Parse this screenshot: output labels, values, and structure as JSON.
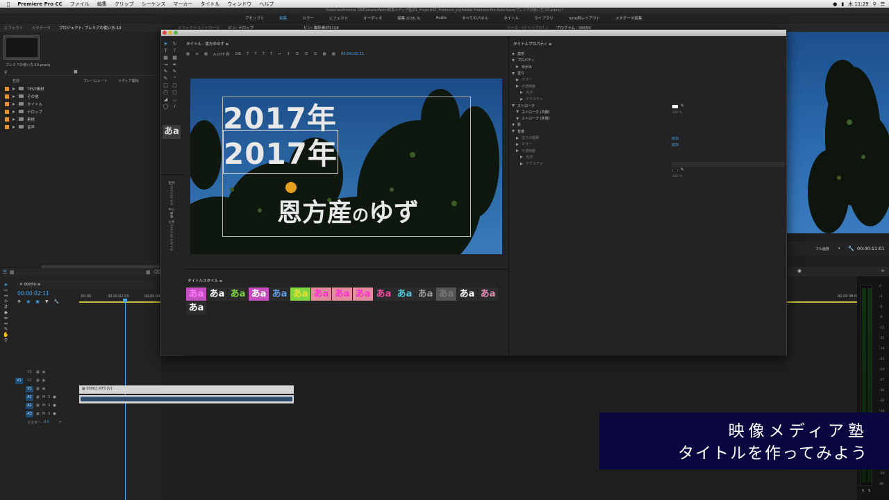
{
  "menubar": {
    "app": "Premiere Pro CC",
    "items": [
      "ファイル",
      "編集",
      "クリップ",
      "シーケンス",
      "マーカー",
      "タイトル",
      "ウィンドウ",
      "ヘルプ"
    ],
    "clock": "木 11:29"
  },
  "path": "/Volumes/Promise RAID/share/Work/映像メディア塾/01_Project/01_Premiere_prj/Adobe Premiere Pro Auto-Save/プレミアの使い方-10.prproj *",
  "workspaces": [
    "アセンブリ",
    "編集",
    "カラー",
    "エフェクト",
    "オーディオ",
    "編集 (CS5.5)",
    "Audio",
    "すべてのパネル",
    "タイトル",
    "ライブラリ",
    "note用レイアウト",
    "メタデータ編集"
  ],
  "project_panel": {
    "tabs": [
      "エフェクト",
      "メタデータ",
      "プロジェクト: プレミアの使い方-10"
    ],
    "filename": "プレミアの使い方-10.prproj",
    "columns": [
      "名前",
      "フレームレート",
      "メディア開始"
    ],
    "folders": [
      "TEST素材",
      "その他",
      "タイトル",
      "テロップ",
      "素材",
      "音声"
    ]
  },
  "title_window": {
    "header": "タイトル : 恩方のゆず",
    "font": "A-OTF 新",
    "style": "DB",
    "timecode": "00:00:02:11",
    "text_line1": "2017年",
    "text_line2": "2017年",
    "text_line3_a": "恩方産",
    "text_line3_b": "の",
    "text_line3_c": "ゆず",
    "styles_header": "タイトルスタイル",
    "swatch_text": "あa",
    "tools_labels": {
      "align": "整列",
      "center": "中心",
      "distribute": "分布"
    }
  },
  "title_props": {
    "header": "タイトルプロパティ",
    "rows": [
      {
        "t": "変形",
        "indent": 0
      },
      {
        "t": "プロパティ",
        "indent": 0
      },
      {
        "t": "ゆがみ",
        "indent": 1
      },
      {
        "t": "塗り",
        "indent": 0
      },
      {
        "t": "カラー",
        "indent": 1,
        "dim": true
      },
      {
        "t": "不透明度",
        "indent": 1,
        "dim": true
      },
      {
        "t": "光沢",
        "indent": 2,
        "dim": true
      },
      {
        "t": "テクスチャ",
        "indent": 2,
        "dim": true
      },
      {
        "t": "ストローク",
        "indent": 0
      },
      {
        "t": "ストローク (内側)",
        "indent": 1
      },
      {
        "t": "ストローク (外側)",
        "indent": 1
      },
      {
        "t": "影",
        "indent": 0
      },
      {
        "t": "背景",
        "indent": 0
      },
      {
        "t": "塗りの種類",
        "indent": 1,
        "dim": true
      },
      {
        "t": "カラー",
        "indent": 1,
        "dim": true
      },
      {
        "t": "不透明度",
        "indent": 1,
        "dim": true
      },
      {
        "t": "光沢",
        "indent": 2,
        "dim": true
      },
      {
        "t": "テクスチャ",
        "indent": 2,
        "dim": true
      }
    ],
    "opacity_val": "100 %",
    "add_label": "追加"
  },
  "source_tabs": {
    "effect_controls": "エフェクトコントロール",
    "bin": "ビン: テロップ",
    "bin2": "ビン: 撮影素材1218",
    "source": "ソース : (クリップなし)",
    "program": "プログラム : 00050"
  },
  "program": {
    "quality": "フル画質",
    "timecode": "00:00:11:01"
  },
  "timeline": {
    "sequence": "00050",
    "timecode": "00:00:02:11",
    "ruler": [
      ":00:00",
      "00:00:02:00",
      "00:00:04:00"
    ],
    "ruler_right": "00:00:38:00",
    "tracks_video": [
      "V3",
      "V2",
      "V1"
    ],
    "tracks_audio": [
      "A1",
      "A2",
      "A3"
    ],
    "master": "マスター",
    "master_val": "0.0",
    "clip_name": "00061.MTS [V]"
  },
  "meter_labels": [
    "0",
    "-3",
    "-6",
    "-9",
    "-12",
    "-15",
    "-18",
    "-21",
    "-24",
    "-27",
    "-30",
    "-33",
    "-36",
    "-39",
    "-42",
    "-45",
    "-48",
    "-51",
    "-54",
    "dB"
  ],
  "meter_bottom": [
    "S",
    "S"
  ],
  "overlay": {
    "line1": "映像メディア塾",
    "line2": "タイトルを作ってみよう"
  },
  "colors": {
    "accent": "#4aa3e6",
    "overlay_bg": "#0a0640",
    "folder": "#e8912d"
  }
}
